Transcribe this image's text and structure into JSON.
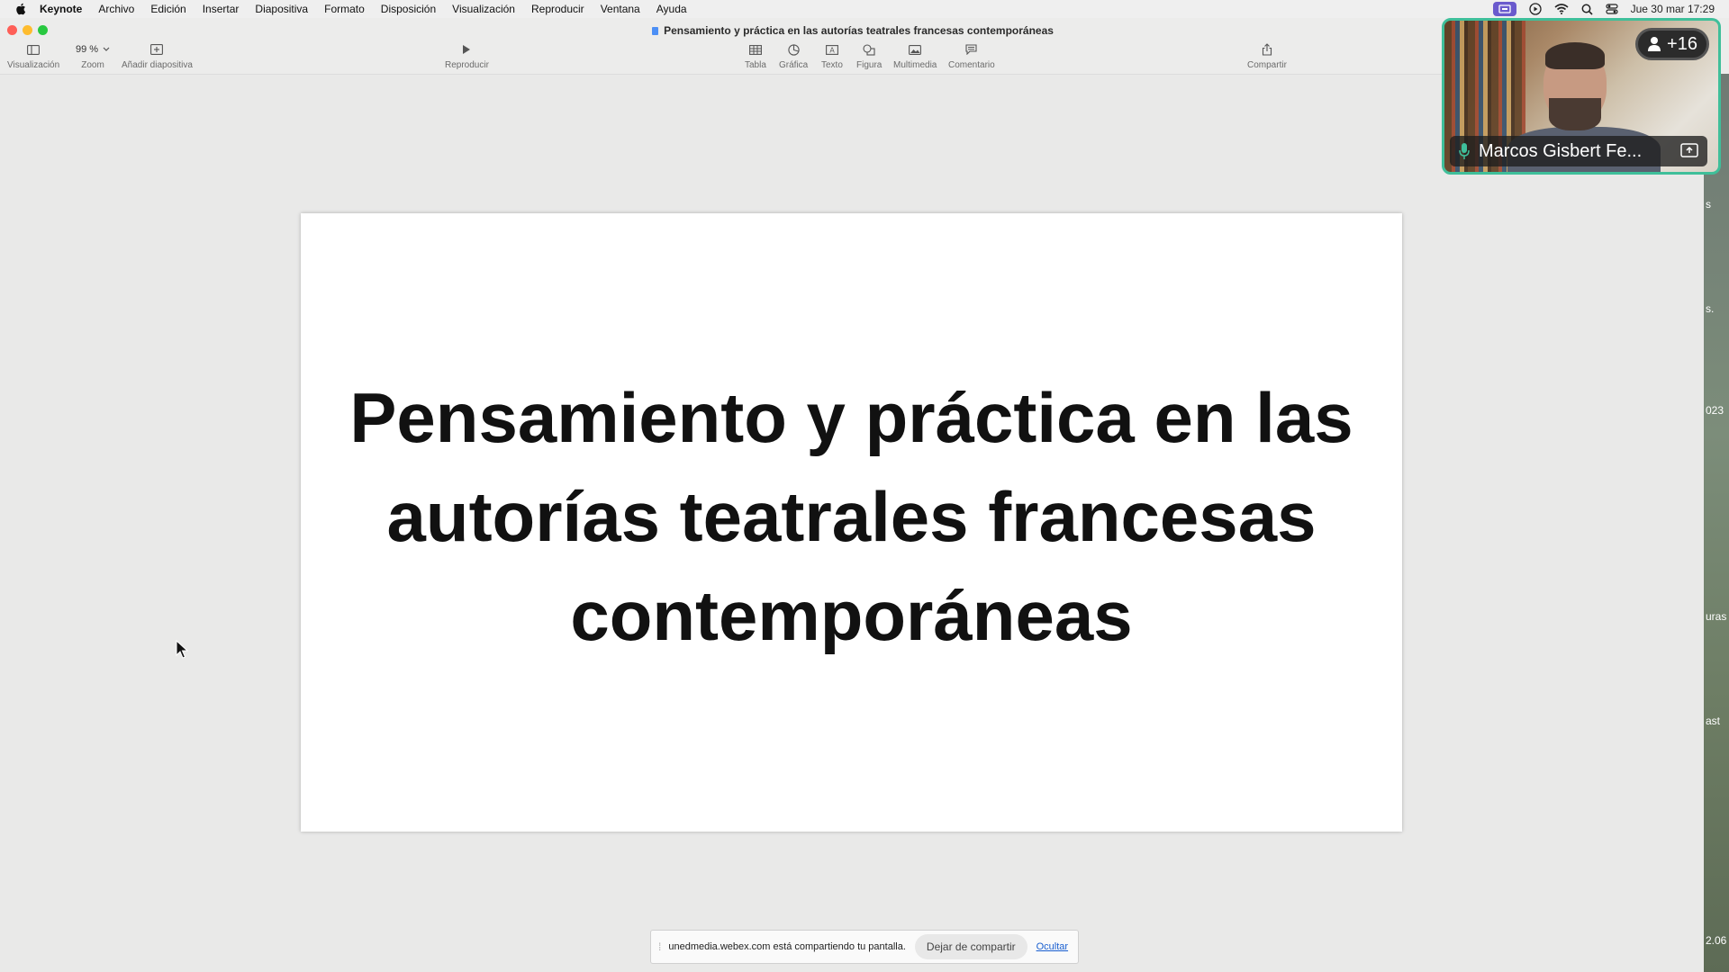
{
  "menubar": {
    "app_name": "Keynote",
    "items": [
      "Archivo",
      "Edición",
      "Insertar",
      "Diapositiva",
      "Formato",
      "Disposición",
      "Visualización",
      "Reproducir",
      "Ventana",
      "Ayuda"
    ],
    "clock": "Jue 30 mar 17:29"
  },
  "window": {
    "title": "Pensamiento y práctica en las autorías teatrales francesas contemporáneas"
  },
  "toolbar": {
    "view_label": "Visualización",
    "zoom_value": "99 %",
    "zoom_label": "Zoom",
    "add_slide_label": "Añadir diapositiva",
    "play_label": "Reproducir",
    "table_label": "Tabla",
    "chart_label": "Gráfica",
    "text_label": "Texto",
    "shape_label": "Figura",
    "media_label": "Multimedia",
    "comment_label": "Comentario",
    "share_label": "Compartir"
  },
  "slide": {
    "title_line1": "Pensamiento y práctica en las",
    "title_line2": "autorías teatrales francesas",
    "title_line3": "contemporáneas"
  },
  "video": {
    "participant_name": "Marcos Gisbert Fe...",
    "participant_count": "+16"
  },
  "share_bar": {
    "message": "unedmedia.webex.com está compartiendo tu pantalla.",
    "stop_label": "Dejar de compartir",
    "hide_label": "Ocultar"
  },
  "edge_fragments": [
    "s",
    "s.",
    "023",
    "uras",
    "ast",
    "2.06"
  ]
}
